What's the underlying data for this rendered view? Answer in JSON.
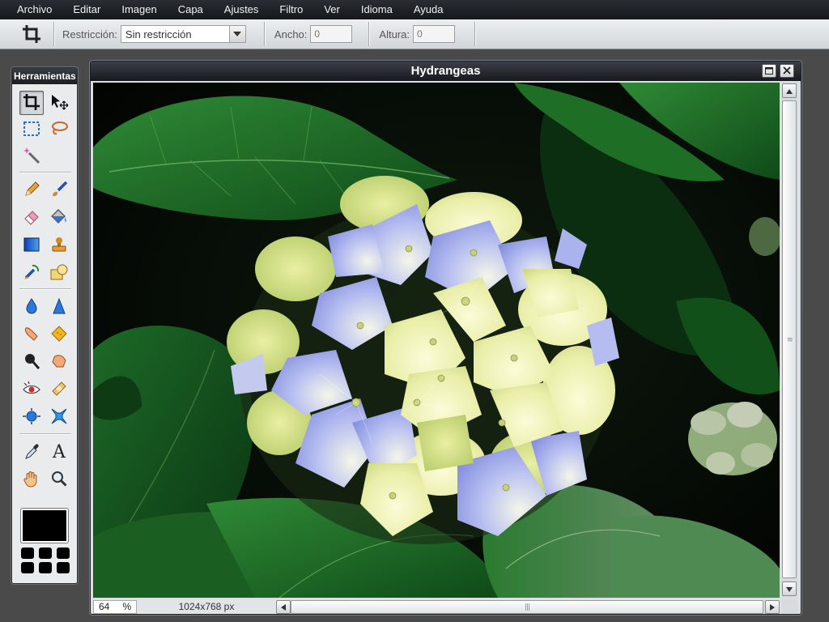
{
  "menubar": {
    "items": [
      "Archivo",
      "Editar",
      "Imagen",
      "Capa",
      "Ajustes",
      "Filtro",
      "Ver",
      "Idioma",
      "Ayuda"
    ]
  },
  "toolbar": {
    "tool_icon": "crop-icon",
    "restriction_label": "Restricción:",
    "restriction_value": "Sin restricción",
    "width_label": "Ancho:",
    "width_value": "0",
    "height_label": "Altura:",
    "height_value": "0"
  },
  "tools_panel": {
    "title": "Herramientas",
    "tools": [
      {
        "name": "crop-tool",
        "icon": "crop-icon",
        "active": true
      },
      {
        "name": "move-tool",
        "icon": "move-arrow-icon"
      },
      {
        "name": "marquee-tool",
        "icon": "marquee-icon"
      },
      {
        "name": "lasso-tool",
        "icon": "lasso-icon"
      },
      {
        "name": "magic-wand-tool",
        "icon": "magic-wand-icon"
      },
      {
        "name": "pencil-tool",
        "icon": "pencil-icon"
      },
      {
        "name": "brush-tool",
        "icon": "brush-icon"
      },
      {
        "name": "eraser-tool",
        "icon": "eraser-icon"
      },
      {
        "name": "fill-tool",
        "icon": "paint-bucket-icon"
      },
      {
        "name": "gradient-tool",
        "icon": "gradient-icon"
      },
      {
        "name": "stamp-tool",
        "icon": "clone-stamp-icon"
      },
      {
        "name": "color-replace-tool",
        "icon": "color-replace-icon"
      },
      {
        "name": "shape-tool",
        "icon": "shape-icon"
      },
      {
        "name": "blur-tool",
        "icon": "drop-icon"
      },
      {
        "name": "sharpen-tool",
        "icon": "sharpen-cone-icon"
      },
      {
        "name": "smudge-tool",
        "icon": "smudge-finger-icon"
      },
      {
        "name": "sponge-tool",
        "icon": "sponge-icon"
      },
      {
        "name": "dodge-tool",
        "icon": "dodge-icon"
      },
      {
        "name": "burn-tool",
        "icon": "burn-hand-icon"
      },
      {
        "name": "red-eye-tool",
        "icon": "red-eye-icon"
      },
      {
        "name": "spot-heal-tool",
        "icon": "bandage-icon"
      },
      {
        "name": "bloat-tool",
        "icon": "bloat-icon"
      },
      {
        "name": "pinch-tool",
        "icon": "pinch-icon"
      },
      {
        "name": "color-picker-tool",
        "icon": "eyedropper-icon"
      },
      {
        "name": "type-tool",
        "icon": "type-icon",
        "glyph": "A"
      },
      {
        "name": "hand-tool",
        "icon": "hand-icon"
      },
      {
        "name": "zoom-tool",
        "icon": "magnifier-icon"
      }
    ],
    "foreground_color": "#000000"
  },
  "document": {
    "title": "Hydrangeas",
    "zoom_value": "64",
    "zoom_unit": "%",
    "image_size": "1024x768 px"
  },
  "colors": {
    "menubar_bg": "#1c1e22",
    "leaf_green": "#1f6b28",
    "petal_blue": "#8c96e6",
    "petal_cream": "#eef2b4"
  }
}
